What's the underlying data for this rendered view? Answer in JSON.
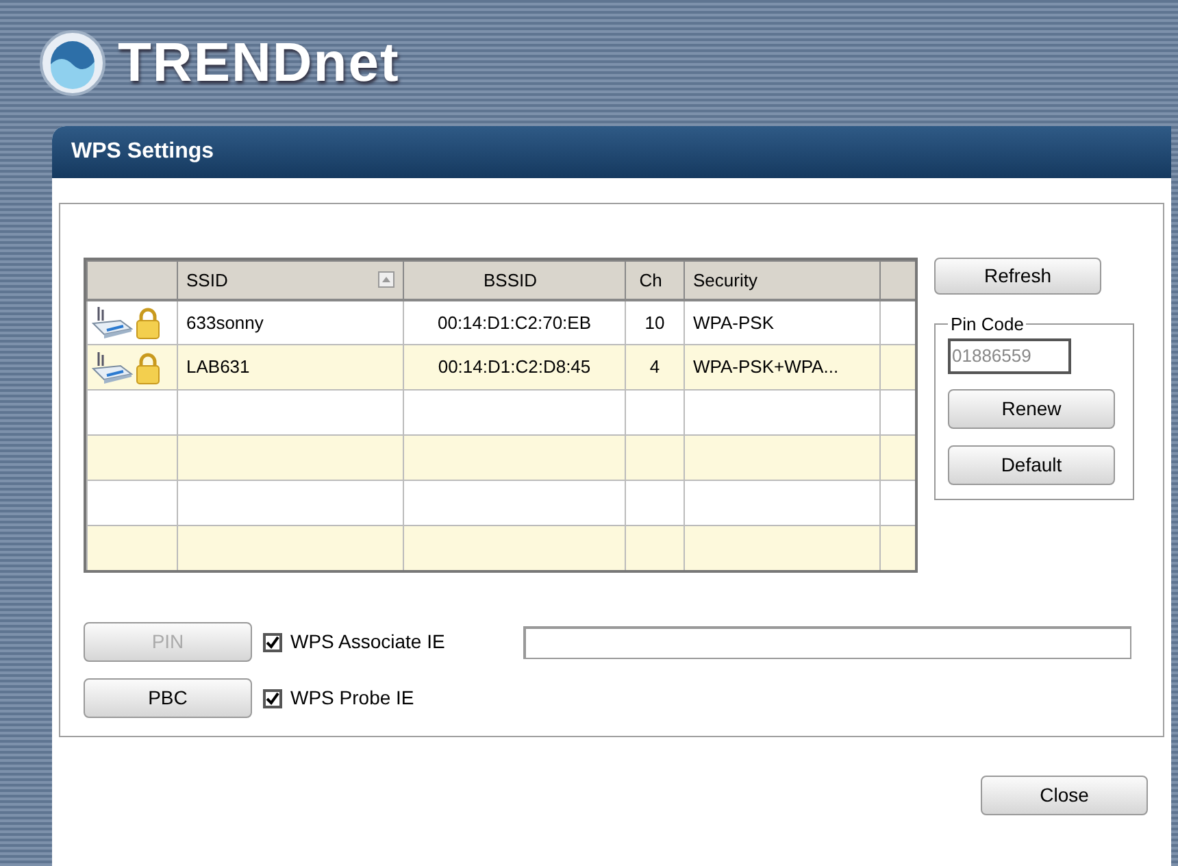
{
  "brand": {
    "name": "TRENDnet"
  },
  "window": {
    "title": "WPS Settings"
  },
  "table": {
    "columns": [
      {
        "label": "SSID",
        "sorted": true
      },
      {
        "label": "BSSID",
        "sorted": false
      },
      {
        "label": "Ch",
        "sorted": false
      },
      {
        "label": "Security",
        "sorted": false
      }
    ],
    "rows": [
      {
        "ssid": "633sonny",
        "bssid": "00:14:D1:C2:70:EB",
        "ch": "10",
        "security": "WPA-PSK",
        "secured": true
      },
      {
        "ssid": "LAB631",
        "bssid": "00:14:D1:C2:D8:45",
        "ch": "4",
        "security": "WPA-PSK+WPA...",
        "secured": true
      }
    ]
  },
  "refresh_button": {
    "label": "Refresh"
  },
  "pin_code": {
    "legend": "Pin Code",
    "value": "01886559",
    "buttons": [
      {
        "label": "Renew"
      },
      {
        "label": "Default"
      }
    ]
  },
  "actions": [
    {
      "label": "PIN",
      "disabled": true,
      "checkbox": {
        "label": "WPS Associate IE",
        "checked": true
      }
    },
    {
      "label": "PBC",
      "disabled": false,
      "checkbox": {
        "label": "WPS Probe IE",
        "checked": true
      }
    }
  ],
  "close_button": {
    "label": "Close"
  }
}
